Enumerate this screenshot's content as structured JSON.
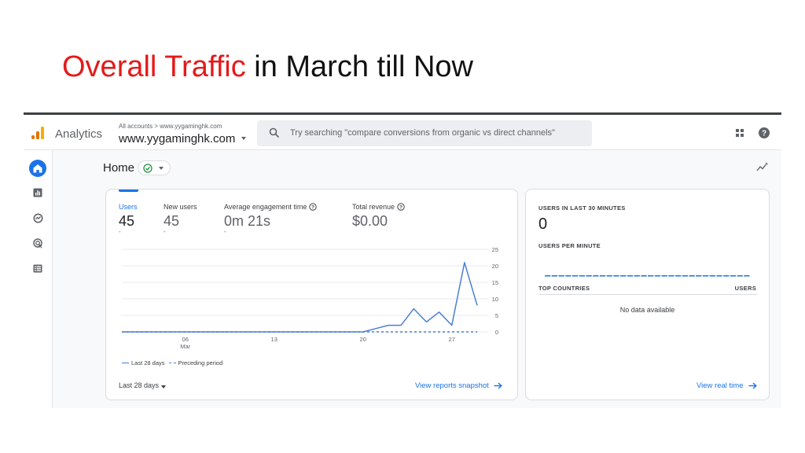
{
  "slide": {
    "title_highlight": "Overall Traffic",
    "title_rest": " in March till Now"
  },
  "topbar": {
    "product_name": "Analytics",
    "account_breadcrumb": "All accounts > www.yygaminghk.com",
    "account_name": "www.yygaminghk.com",
    "search_placeholder": "Try searching \"compare conversions from organic vs direct channels\""
  },
  "sidebar": {
    "items": [
      {
        "icon": "home-icon",
        "active": true
      },
      {
        "icon": "reports-icon",
        "active": false
      },
      {
        "icon": "explore-icon",
        "active": false
      },
      {
        "icon": "advertising-icon",
        "active": false
      },
      {
        "icon": "configure-icon",
        "active": false
      }
    ]
  },
  "home": {
    "title": "Home"
  },
  "metrics": [
    {
      "label": "Users",
      "value": "45",
      "sub": "-"
    },
    {
      "label": "New users",
      "value": "45",
      "sub": "-"
    },
    {
      "label": "Average engagement time",
      "value": "0m 21s",
      "sub": "-"
    },
    {
      "label": "Total revenue",
      "value": "$0.00",
      "sub": ""
    }
  ],
  "chart_data": {
    "type": "line",
    "x": [
      1,
      2,
      3,
      4,
      5,
      6,
      7,
      8,
      9,
      10,
      11,
      12,
      13,
      14,
      15,
      16,
      17,
      18,
      19,
      20,
      21,
      22,
      23,
      24,
      25,
      26,
      27,
      28
    ],
    "series": [
      {
        "name": "Last 28 days",
        "values": [
          0,
          0,
          0,
          0,
          0,
          0,
          0,
          0,
          0,
          0,
          0,
          0,
          0,
          0,
          0,
          0,
          0,
          0,
          0,
          0,
          1,
          2,
          2,
          7,
          3,
          6,
          2,
          21,
          8
        ]
      },
      {
        "name": "Preceding period",
        "values": [
          0,
          0,
          0,
          0,
          0,
          0,
          0,
          0,
          0,
          0,
          0,
          0,
          0,
          0,
          0,
          0,
          0,
          0,
          0,
          0,
          0,
          0,
          0,
          0,
          0,
          0,
          0,
          0,
          0
        ]
      }
    ],
    "x_tick_labels": [
      {
        "x": 6,
        "label": "06",
        "sub": "Mar"
      },
      {
        "x": 13,
        "label": "13",
        "sub": ""
      },
      {
        "x": 20,
        "label": "20",
        "sub": ""
      },
      {
        "x": 27,
        "label": "27",
        "sub": ""
      }
    ],
    "y_ticks": [
      0,
      5,
      10,
      15,
      20,
      25
    ],
    "ylim": [
      0,
      25
    ],
    "legend": [
      "Last 28 days",
      "Preceding period"
    ],
    "legend_position": "bottom-left",
    "grid": true,
    "line_color": "#4a7fd8"
  },
  "card_footer": {
    "date_range": "Last 28 days",
    "link": "View reports snapshot"
  },
  "realtime": {
    "users_label": "USERS IN LAST 30 MINUTES",
    "users_value": "0",
    "per_minute_label": "USERS PER MINUTE",
    "countries_label": "TOP COUNTRIES",
    "users_col": "USERS",
    "no_data": "No data available",
    "link": "View real time"
  },
  "colors": {
    "accent": "#1a73e8",
    "title_red": "#e31b1b"
  }
}
